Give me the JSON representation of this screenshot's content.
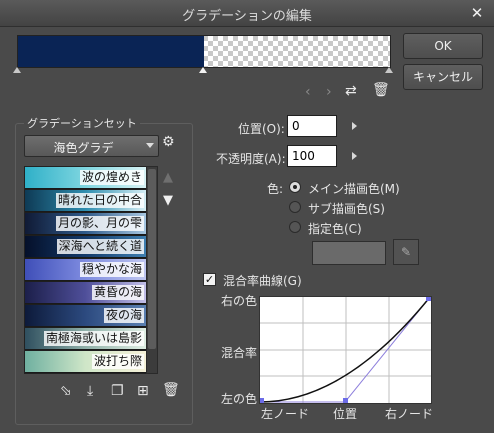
{
  "window": {
    "title": "グラデーションの編集",
    "close_icon": "close-icon"
  },
  "buttons": {
    "ok": "OK",
    "cancel": "キャンセル"
  },
  "gradient_preview": {
    "color": "#0a2455"
  },
  "gradient_set": {
    "label": "グラデーションセット",
    "selected": "海色グラデ",
    "items": [
      {
        "label": "波の煌めき",
        "colors": [
          "#2fb0c8",
          "#7fd6e0",
          "#d8f2f4"
        ]
      },
      {
        "label": "晴れた日の中合",
        "colors": [
          "#0e3a55",
          "#2f8fb0",
          "#d5eef5"
        ]
      },
      {
        "label": "月の影、月の雫",
        "colors": [
          "#101a35",
          "#2f5a8a",
          "#a8c8e2"
        ]
      },
      {
        "label": "深海へと続く道",
        "colors": [
          "#05102a",
          "#143a6a",
          "#3f7fb0"
        ]
      },
      {
        "label": "穏やかな海",
        "colors": [
          "#3f4fb8",
          "#7f8ce0",
          "#bfc6f0"
        ]
      },
      {
        "label": "黄昏の海",
        "colors": [
          "#1c1f4a",
          "#4f4f9a",
          "#c2bfe8"
        ]
      },
      {
        "label": "夜の海",
        "colors": [
          "#0d1a3a",
          "#2c4a7f",
          "#5a7fb0"
        ]
      },
      {
        "label": "南極海或いは島影",
        "colors": [
          "#2f4f5f",
          "#8fb0a8",
          "#e0efe4"
        ]
      },
      {
        "label": "波打ち際",
        "colors": [
          "#6fb0a0",
          "#cfe6c8",
          "#f5f1d8"
        ]
      }
    ]
  },
  "properties": {
    "position_label": "位置(O):",
    "position_value": "0",
    "opacity_label": "不透明度(A):",
    "opacity_value": "100",
    "color_label": "色:",
    "radio": [
      "メイン描画色(M)",
      "サブ描画色(S)",
      "指定色(C)"
    ]
  },
  "curve": {
    "checkbox_label": "混合率曲線(G)",
    "y_top": "右の色",
    "y_mid": "混合率",
    "y_bottom": "左の色",
    "x_left": "左ノード",
    "x_mid": "位置",
    "x_right": "右ノード"
  }
}
